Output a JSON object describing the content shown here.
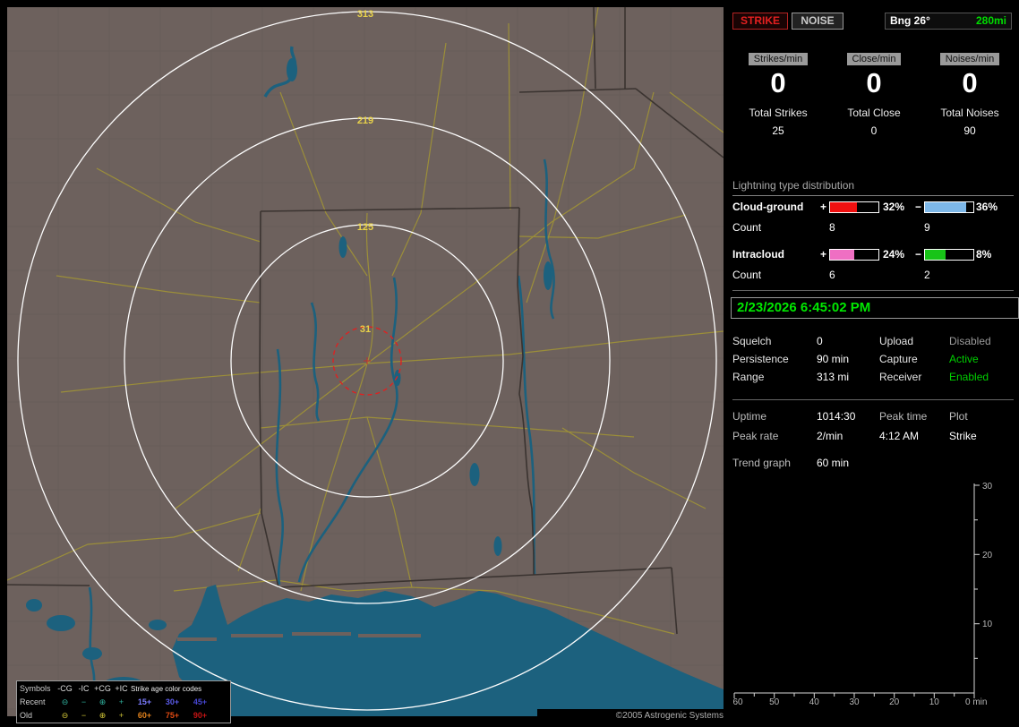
{
  "map": {
    "ring_labels": [
      "313",
      "219",
      "125",
      "31"
    ],
    "copyright": "©2005 Astrogenic Systems",
    "legend": {
      "symbols_header": "Symbols",
      "type_headers": [
        "-CG",
        "-IC",
        "+CG",
        "+IC"
      ],
      "age_header": "Strike age color codes",
      "rows": [
        {
          "label": "Recent",
          "symbols": [
            "⊖",
            "−",
            "⊕",
            "+"
          ],
          "symbol_color": "#2fae9b",
          "ages": [
            "15+",
            "30+",
            "45+"
          ],
          "age_colors": [
            "#7b7bff",
            "#5b5bea",
            "#4646d0"
          ]
        },
        {
          "label": "Old",
          "symbols": [
            "⊖",
            "−",
            "⊕",
            "+"
          ],
          "symbol_color": "#cfc437",
          "ages": [
            "60+",
            "75+",
            "90+"
          ],
          "age_colors": [
            "#e2821c",
            "#e04a12",
            "#c51414"
          ]
        }
      ]
    },
    "colors": {
      "land": "#6d615d",
      "water": "#1c617e",
      "roads": "#a09336",
      "rings": "#fdfdfd",
      "ring_label": "#e8d24a",
      "alarm_ring": "#dd2222"
    }
  },
  "sidebar": {
    "strike_button": "STRIKE",
    "noise_button": "NOISE",
    "bearing_label": "Bng 26°",
    "bearing_range": "280mi",
    "rates": [
      {
        "label": "Strikes/min",
        "value": "0",
        "total_label": "Total Strikes",
        "total_value": "25"
      },
      {
        "label": "Close/min",
        "value": "0",
        "total_label": "Total Close",
        "total_value": "0"
      },
      {
        "label": "Noises/min",
        "value": "0",
        "total_label": "Total Noises",
        "total_value": "90"
      }
    ],
    "distribution": {
      "header": "Lightning type distribution",
      "plus_sign": "+",
      "minus_sign": "−",
      "rows": [
        {
          "label": "Cloud-ground",
          "count_label": "Count",
          "plus_pct": "32%",
          "plus_count": "8",
          "plus_color": "#f01010",
          "plus_fill": 55,
          "minus_pct": "36%",
          "minus_count": "9",
          "minus_color": "#7db7e8",
          "minus_fill": 86
        },
        {
          "label": "Intracloud",
          "count_label": "Count",
          "plus_pct": "24%",
          "plus_count": "6",
          "plus_color": "#ef6fc3",
          "plus_fill": 50,
          "minus_pct": "8%",
          "minus_count": "2",
          "minus_color": "#18c418",
          "minus_fill": 42
        }
      ]
    },
    "datetime": "2/23/2026 6:45:02 PM",
    "settings": [
      {
        "label": "Squelch",
        "value": "0",
        "label2": "Upload",
        "value2": "Disabled",
        "value2_color": "#9a9a9a"
      },
      {
        "label": "Persistence",
        "value": "90 min",
        "label2": "Capture",
        "value2": "Active",
        "value2_color": "#00d000"
      },
      {
        "label": "Range",
        "value": "313 mi",
        "label2": "Receiver",
        "value2": "Enabled",
        "value2_color": "#00d000"
      }
    ],
    "stats": {
      "uptime_label": "Uptime",
      "uptime_value": "1014:30",
      "peak_time_label": "Peak time",
      "peak_time_value": "4:12 AM",
      "plot_label": "Plot",
      "plot_value": "Strike",
      "peak_rate_label": "Peak rate",
      "peak_rate_value": "2/min",
      "trend_label": "Trend graph",
      "trend_value": "60 min"
    },
    "trend_graph": {
      "y_ticks": [
        "30",
        "20",
        "10"
      ],
      "x_ticks": [
        "60",
        "50",
        "40",
        "30",
        "20",
        "10"
      ],
      "origin_label": "0 min"
    }
  }
}
